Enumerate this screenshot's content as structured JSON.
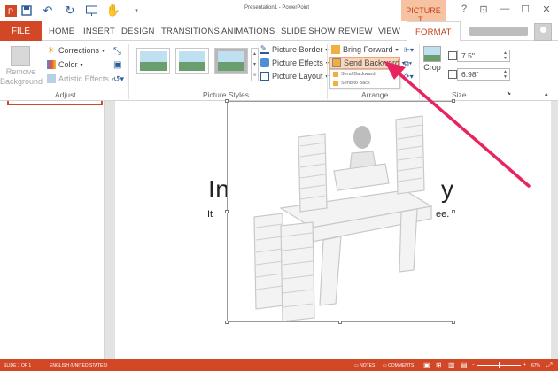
{
  "window": {
    "title": "Presentation1 - PowerPoint",
    "contextual_tab": "PICTURE T..."
  },
  "tabs": [
    "FILE",
    "HOME",
    "INSERT",
    "DESIGN",
    "TRANSITIONS",
    "ANIMATIONS",
    "SLIDE SHOW",
    "REVIEW",
    "VIEW",
    "FORMAT"
  ],
  "ribbon": {
    "adjust": {
      "remove_background": "Remove Background",
      "corrections": "Corrections",
      "color": "Color",
      "artistic_effects": "Artistic Effects",
      "label": "Adjust"
    },
    "picture_styles": {
      "picture_border": "Picture Border",
      "picture_effects": "Picture Effects",
      "picture_layout": "Picture Layout",
      "label": "Picture Styles"
    },
    "arrange": {
      "bring_forward": "Bring Forward",
      "send_backward": "Send Backward",
      "menu_send_backward": "Send Backward",
      "menu_send_to_back": "Send to Back",
      "label": "Arrange"
    },
    "size": {
      "crop": "Crop",
      "height": "7.5\"",
      "width": "6.98\"",
      "label": "Size"
    }
  },
  "slide": {
    "title_left": "In",
    "title_right": "y",
    "sub_left": "It",
    "sub_right": "ee."
  },
  "status": {
    "slide_count": "SLIDE 1 OF 1",
    "language": "ENGLISH (UNITED STATES)",
    "notes": "NOTES",
    "comments": "COMMENTS",
    "zoom": "67%"
  },
  "colors": {
    "accent": "#d24726",
    "annotation_arrow": "#e8245e"
  }
}
